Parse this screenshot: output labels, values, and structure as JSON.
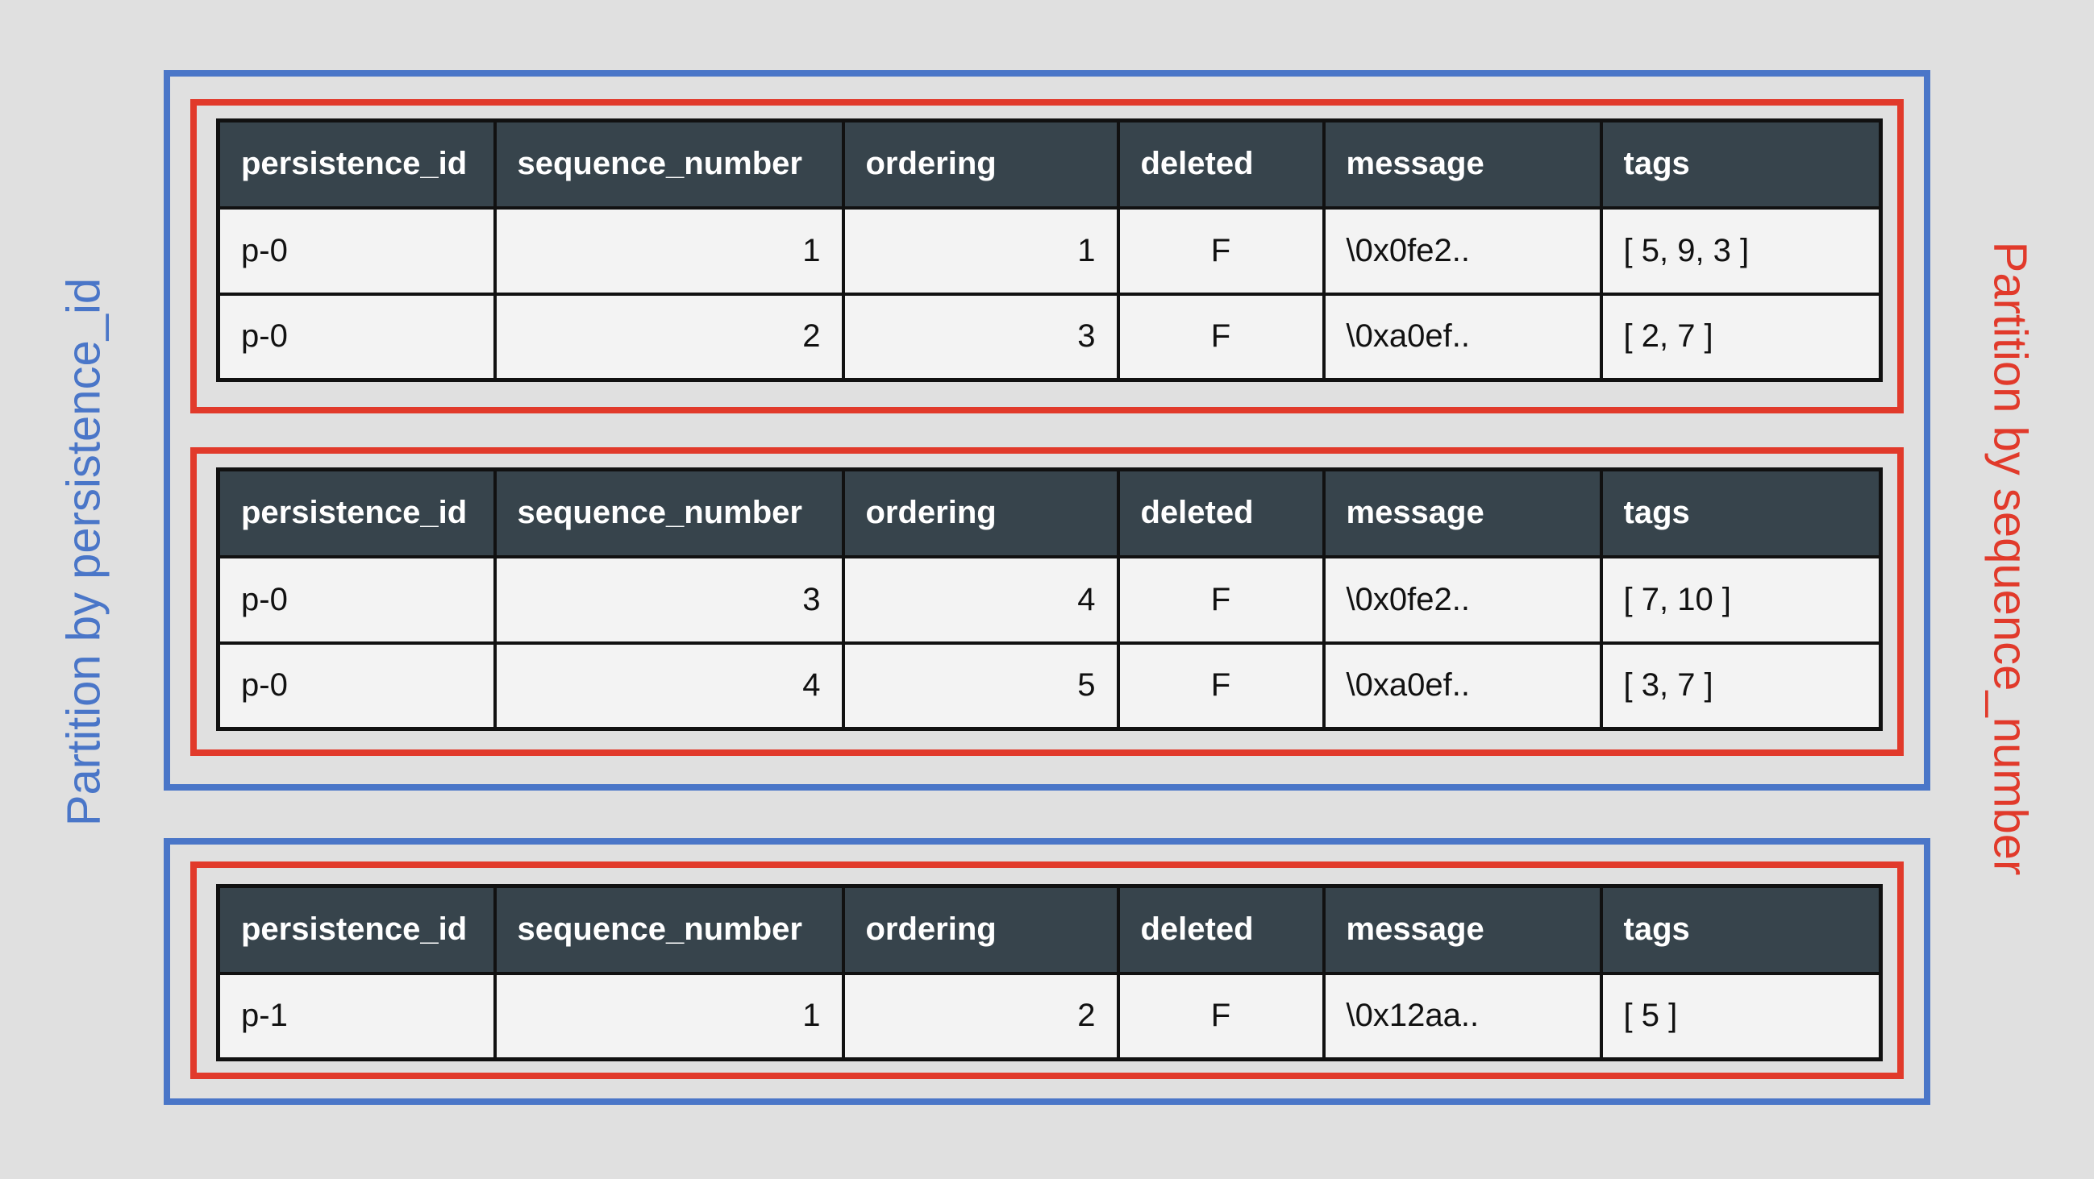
{
  "labels": {
    "left": "Partition by persistence_id",
    "right": "Partition by sequence_number"
  },
  "columns": [
    "persistence_id",
    "sequence_number",
    "ordering",
    "deleted",
    "message",
    "tags"
  ],
  "partitions": [
    {
      "rows": [
        [
          "p-0",
          "1",
          "1",
          "F",
          "\\0x0fe2..",
          "[ 5, 9, 3 ]"
        ],
        [
          "p-0",
          "2",
          "3",
          "F",
          "\\0xa0ef..",
          "[ 2, 7 ]"
        ]
      ]
    },
    {
      "rows": [
        [
          "p-0",
          "3",
          "4",
          "F",
          "\\0x0fe2..",
          "[ 7, 10 ]"
        ],
        [
          "p-0",
          "4",
          "5",
          "F",
          "\\0xa0ef..",
          "[ 3, 7 ]"
        ]
      ]
    },
    {
      "rows": [
        [
          "p-1",
          "1",
          "2",
          "F",
          "\\0x12aa..",
          "[ 5 ]"
        ]
      ]
    }
  ],
  "colors": {
    "persistence_partition": "#4a76c8",
    "sequence_partition": "#e13a2b",
    "header_bg": "#37444c",
    "cell_bg": "#f3f3f3",
    "background": "#e0e0e0"
  }
}
